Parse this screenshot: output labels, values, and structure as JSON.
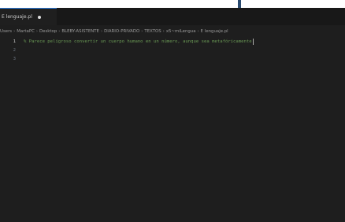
{
  "tab": {
    "label": "E lenguaje.pl"
  },
  "breadcrumb": {
    "parts": [
      "Users",
      "MartaPC",
      "Desktop",
      "BLEBY-ASISTENTE",
      "DIARIO-PRIVADO",
      "TEXTOS",
      "x5~miLengua"
    ],
    "file_icon": "E",
    "file": "lenguaje.pl"
  },
  "editor": {
    "lines": [
      {
        "number": "1",
        "text": "% Parece peligroso convertir un cuerpo humano en un número, aunque sea metafóricamente"
      },
      {
        "number": "2",
        "text": ""
      },
      {
        "number": "3",
        "text": ""
      }
    ]
  },
  "colors": {
    "editor_bg": "#1e1e1e",
    "comment": "#6a9955",
    "tab_accent": "#2b79d7"
  }
}
